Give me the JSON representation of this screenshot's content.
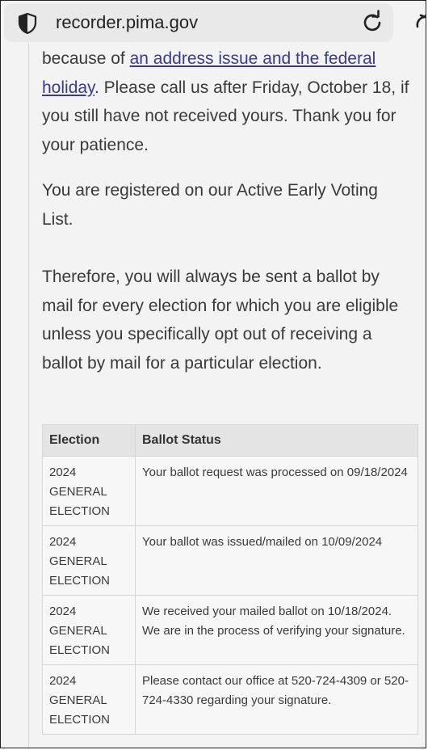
{
  "browser": {
    "url": "recorder.pima.gov"
  },
  "content": {
    "para1_prefix": "because of ",
    "para1_link": "an address issue and the federal holiday",
    "para1_suffix": ". Please call us after Friday, October 18, if you still have not received yours. Thank you for your patience.",
    "para2": "You are registered on our Active Early Voting List.",
    "para3": "Therefore, you will always be sent a ballot by mail for every election for which you are eligible unless you specifically opt out of receiving a ballot by mail for a particular election."
  },
  "table": {
    "headers": [
      "Election",
      "Ballot Status"
    ],
    "rows": [
      {
        "election": [
          "2024",
          "GENERAL",
          "ELECTION"
        ],
        "status": "Your ballot request was processed on 09/18/2024"
      },
      {
        "election": [
          "2024",
          "GENERAL",
          "ELECTION"
        ],
        "status": "Your ballot was issued/mailed on 10/09/2024"
      },
      {
        "election": [
          "2024",
          "GENERAL",
          "ELECTION"
        ],
        "status": "We received your mailed ballot on 10/18/2024. We are in the process of verifying your signature."
      },
      {
        "election": [
          "2024",
          "GENERAL",
          "ELECTION"
        ],
        "status": "Please contact our office at 520-724-4309 or 520-724-4330 regarding your signature."
      }
    ]
  }
}
